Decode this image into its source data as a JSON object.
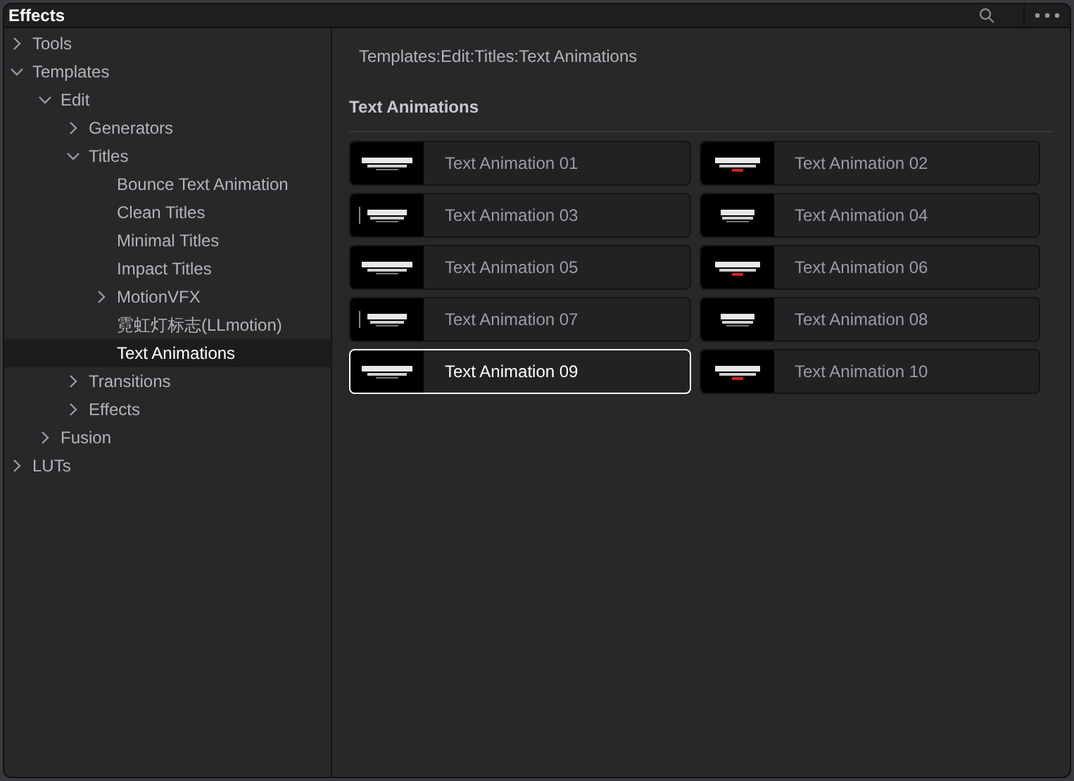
{
  "window": {
    "title": "Effects"
  },
  "tree": [
    {
      "label": "Tools",
      "expanded": false,
      "selected": false
    },
    {
      "label": "Templates",
      "expanded": true,
      "selected": false,
      "children": [
        {
          "label": "Edit",
          "expanded": true,
          "selected": false,
          "children": [
            {
              "label": "Generators",
              "expanded": false,
              "selected": false
            },
            {
              "label": "Titles",
              "expanded": true,
              "selected": false,
              "children": [
                {
                  "label": "Bounce Text Animation",
                  "selected": false
                },
                {
                  "label": "Clean Titles",
                  "selected": false
                },
                {
                  "label": "Minimal Titles",
                  "selected": false
                },
                {
                  "label": "Impact Titles",
                  "selected": false
                },
                {
                  "label": "MotionVFX",
                  "expanded": false,
                  "selected": false
                },
                {
                  "label": "霓虹灯标志(LLmotion)",
                  "selected": false
                },
                {
                  "label": "Text Animations",
                  "selected": true
                }
              ]
            },
            {
              "label": "Transitions",
              "expanded": false,
              "selected": false
            },
            {
              "label": "Effects",
              "expanded": false,
              "selected": false
            }
          ]
        },
        {
          "label": "Fusion",
          "expanded": false,
          "selected": false
        }
      ]
    },
    {
      "label": "LUTs",
      "expanded": false,
      "selected": false
    }
  ],
  "breadcrumb": "Templates:Edit:Titles:Text Animations",
  "section_title": "Text Animations",
  "items": [
    {
      "label": "Text Animation 01",
      "selected": false
    },
    {
      "label": "Text Animation 02",
      "selected": false
    },
    {
      "label": "Text Animation 03",
      "selected": false
    },
    {
      "label": "Text Animation 04",
      "selected": false
    },
    {
      "label": "Text Animation 05",
      "selected": false
    },
    {
      "label": "Text Animation 06",
      "selected": false
    },
    {
      "label": "Text Animation 07",
      "selected": false
    },
    {
      "label": "Text Animation 08",
      "selected": false
    },
    {
      "label": "Text Animation 09",
      "selected": true
    },
    {
      "label": "Text Animation 10",
      "selected": false
    }
  ]
}
